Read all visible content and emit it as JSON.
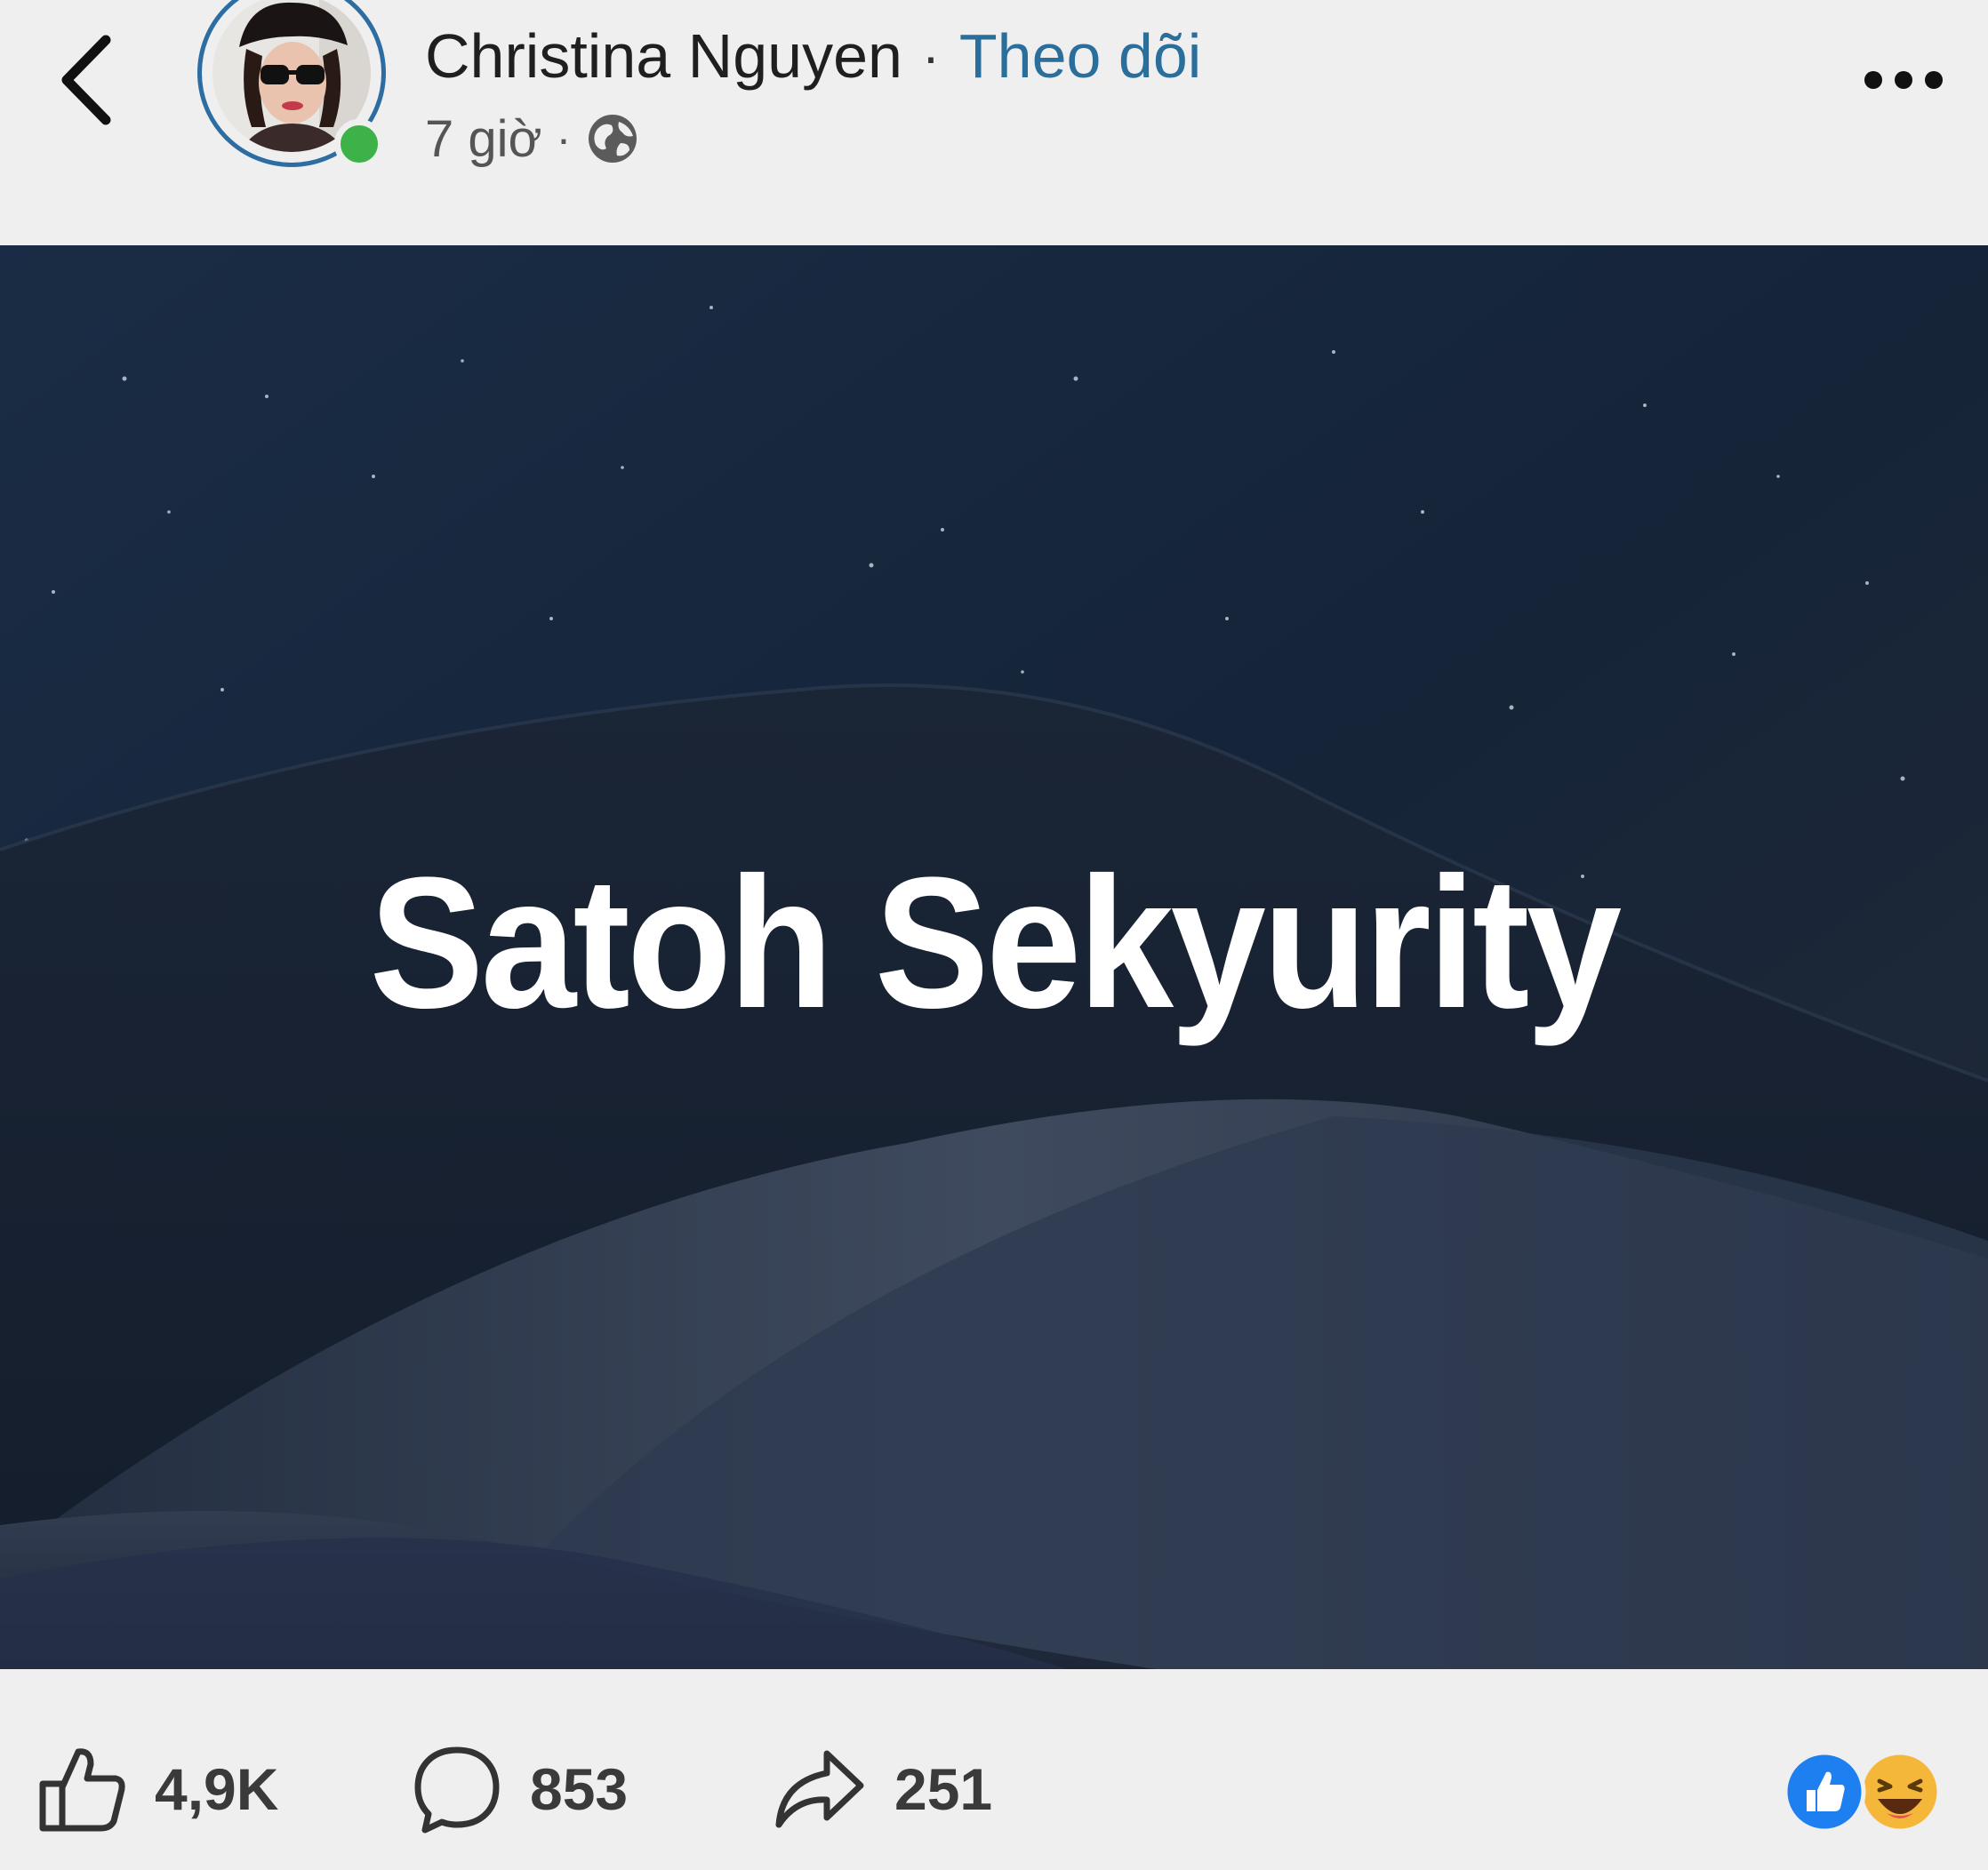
{
  "header": {
    "back_label": "",
    "author_name": "Christina Nguyen",
    "separator": "·",
    "follow_label": "Theo dõi",
    "time": "7 giờ",
    "audience_icon": "globe-icon",
    "more_icon": "more-dots-icon",
    "online_status_color": "#3db249"
  },
  "post": {
    "image_text": "Satoh Sekyurity"
  },
  "footer": {
    "likes": "4,9K",
    "comments": "853",
    "shares": "251",
    "reactions": [
      "like-reaction-icon",
      "haha-reaction-icon"
    ]
  },
  "colors": {
    "accent": "#2a6e9b",
    "background": "#efefef",
    "night_sky": "#142033"
  }
}
